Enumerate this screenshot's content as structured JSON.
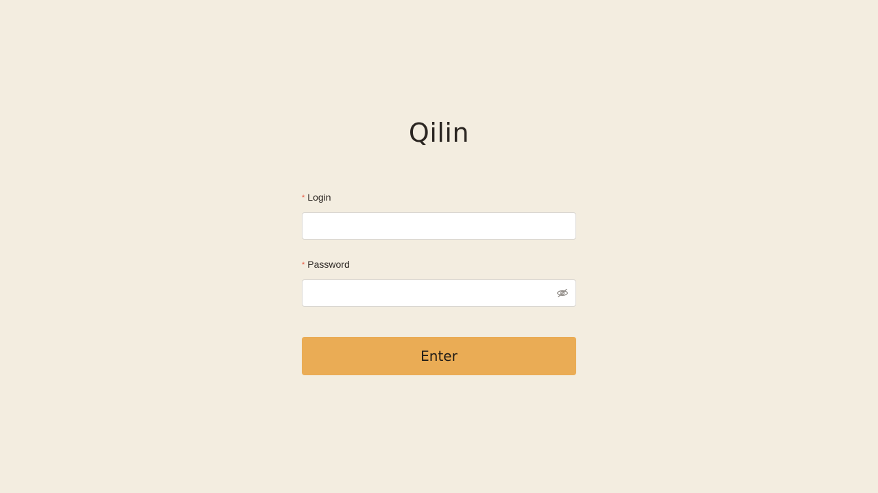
{
  "app": {
    "title": "Qilin"
  },
  "login_form": {
    "login": {
      "required_mark": "*",
      "label": "Login",
      "value": "",
      "placeholder": ""
    },
    "password": {
      "required_mark": "*",
      "label": "Password",
      "value": "",
      "placeholder": "",
      "toggle_icon": "eye-slash-icon"
    },
    "submit_label": "Enter"
  },
  "colors": {
    "background": "#f3ede0",
    "accent": "#eaac55",
    "required": "#e5533c",
    "text": "#2b2622"
  }
}
